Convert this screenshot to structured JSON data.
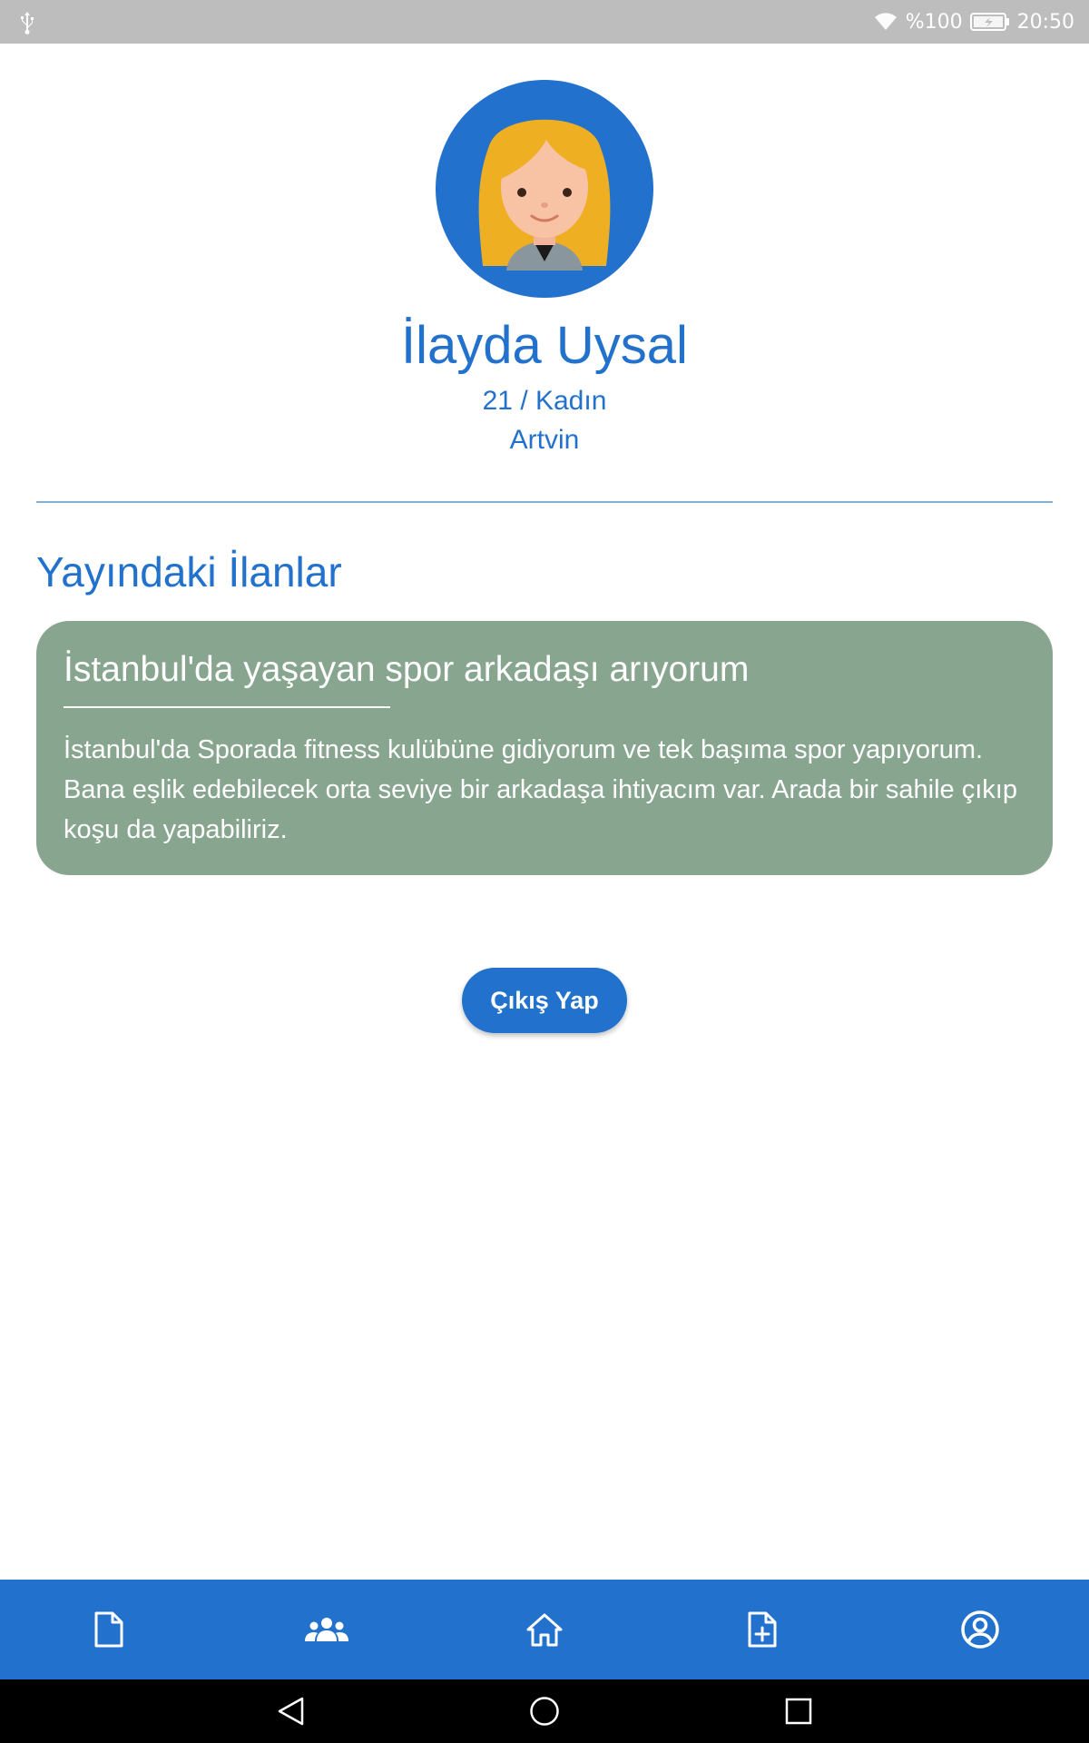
{
  "status_bar": {
    "battery_percent": "%100",
    "time": "20:50",
    "icons": [
      "usb-icon",
      "wifi-icon",
      "battery-charging-icon"
    ]
  },
  "profile": {
    "name": "İlayda Uysal",
    "age_gender": "21 / Kadın",
    "city": "Artvin",
    "avatar": "female-avatar-illustration"
  },
  "listings_section": {
    "title": "Yayındaki İlanlar",
    "items": [
      {
        "title": "İstanbul'da yaşayan spor arkadaşı arıyorum",
        "description": "İstanbul'da Sporada fitness kulübüne gidiyorum ve tek başıma spor yapıyorum. Bana eşlik edebilecek orta seviye bir arkadaşa ihtiyacım var. Arada bir sahile çıkıp koşu da yapabiliriz."
      }
    ]
  },
  "logout_label": "Çıkış Yap",
  "bottom_nav": {
    "items": [
      {
        "icon": "document-icon"
      },
      {
        "icon": "group-icon"
      },
      {
        "icon": "home-icon"
      },
      {
        "icon": "add-document-icon"
      },
      {
        "icon": "account-circle-icon",
        "active": true
      }
    ]
  },
  "colors": {
    "primary": "#2171cd",
    "card": "#88a590",
    "status_bar": "#bdbdbd"
  }
}
